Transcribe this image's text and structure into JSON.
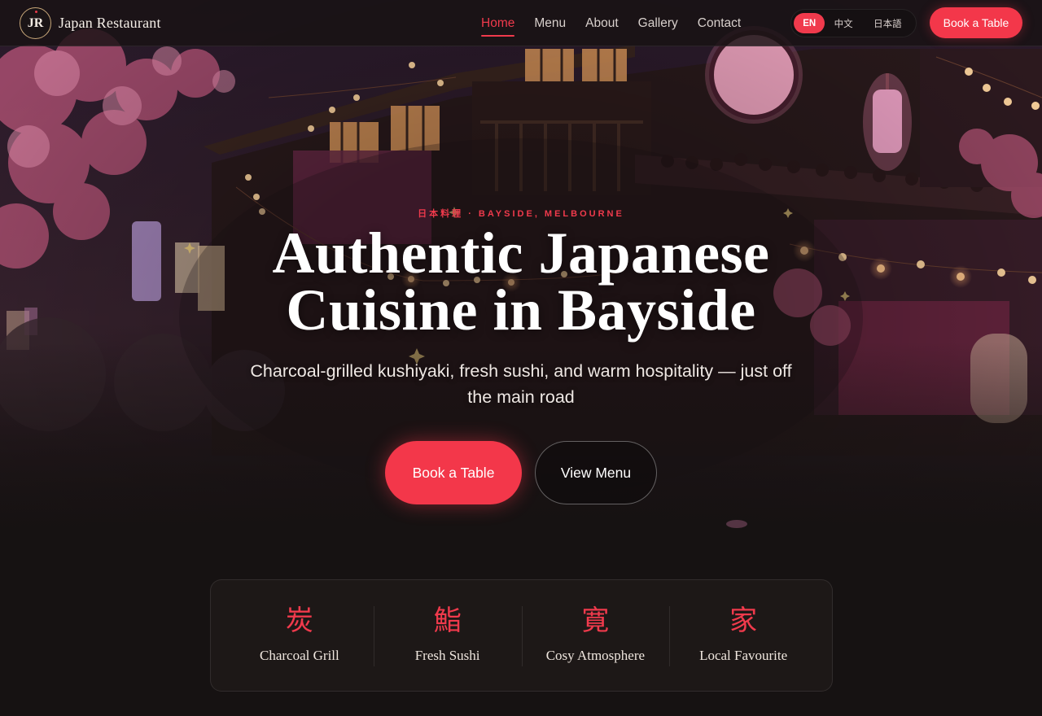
{
  "header": {
    "logo_text": "JR",
    "brand_name": "Japan Restaurant",
    "nav": [
      {
        "label": "Home",
        "active": true
      },
      {
        "label": "Menu",
        "active": false
      },
      {
        "label": "About",
        "active": false
      },
      {
        "label": "Gallery",
        "active": false
      },
      {
        "label": "Contact",
        "active": false
      }
    ],
    "languages": [
      "EN",
      "中文",
      "日本語"
    ],
    "selected_language": "EN",
    "book_label": "Book a Table"
  },
  "hero": {
    "eyebrow": "日本料理 · BAYSIDE, MELBOURNE",
    "headline_line1": "Authentic Japanese",
    "headline_line2": "Cuisine in Bayside",
    "subheadline": "Charcoal-grilled kushiyaki, fresh sushi, and warm hospitality — just off the main road",
    "primary_cta": "Book a Table",
    "secondary_cta": "View Menu"
  },
  "features": [
    {
      "kanji": "炭",
      "label": "Charcoal Grill"
    },
    {
      "kanji": "鮨",
      "label": "Fresh Sushi"
    },
    {
      "kanji": "寛",
      "label": "Cosy Atmosphere"
    },
    {
      "kanji": "家",
      "label": "Local Favourite"
    }
  ],
  "colors": {
    "accent": "#f3374a",
    "background": "#161212",
    "gold": "#c9a87a"
  }
}
